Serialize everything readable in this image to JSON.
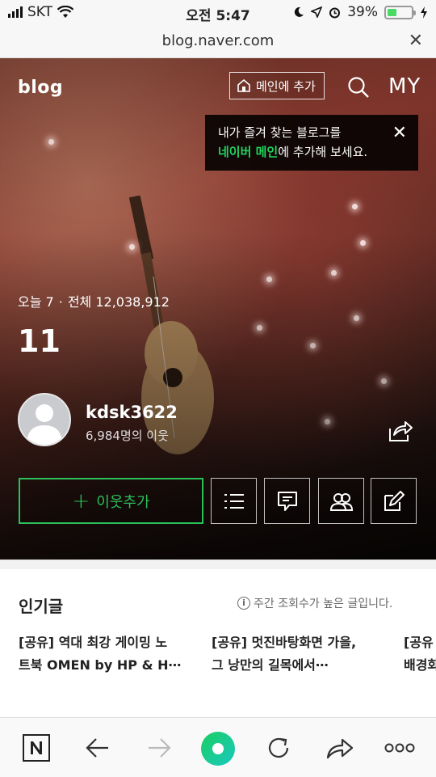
{
  "status_bar": {
    "carrier": "SKT",
    "time": "오전 5:47",
    "battery": "39%",
    "battery_level": 0.39
  },
  "url_bar": {
    "url": "blog.naver.com"
  },
  "header": {
    "logo": "blog",
    "add_main_label": "메인에 추가",
    "my_label": "MY"
  },
  "tooltip": {
    "line1": "내가 즐겨 찾는 블로그를",
    "highlight": "네이버 메인",
    "line2_rest": "에 추가해 보세요."
  },
  "blog": {
    "today_label": "오늘 7",
    "total_label": "전체 12,038,912",
    "title": "11",
    "username": "kdsk3622",
    "neighbors": "6,984명의 이웃"
  },
  "actions": {
    "add_neighbor_label": "이웃추가"
  },
  "popular": {
    "title": "인기글",
    "note": "주간 조회수가 높은 글입니다.",
    "posts": [
      {
        "line1": "[공유] 역대 최강 게이밍 노",
        "line2": "트북 OMEN by HP & H⋯"
      },
      {
        "line1": "[공유] 멋진바탕화면 가을,",
        "line2": "그 낭만의 길목에서⋯"
      },
      {
        "line1": "[공유",
        "line2": "배경화"
      }
    ]
  },
  "colors": {
    "accent_green": "#2bc15a",
    "naver_green": "#03c75a"
  }
}
